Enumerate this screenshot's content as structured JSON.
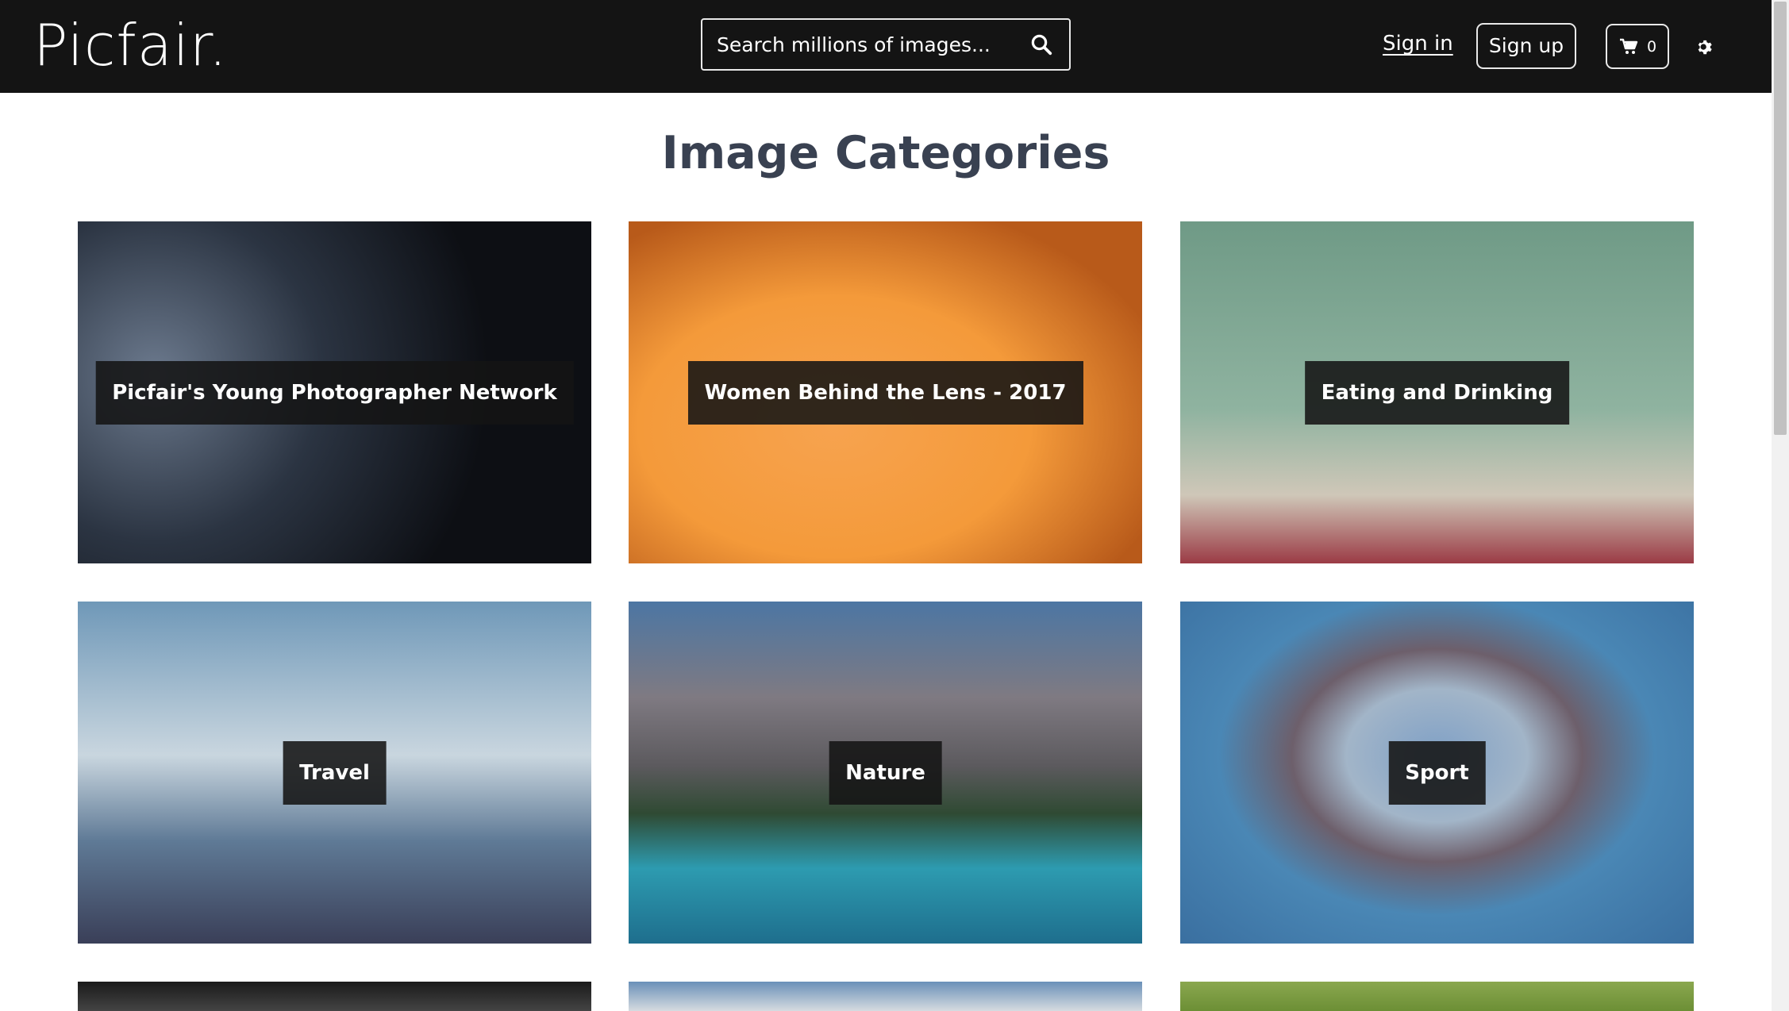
{
  "header": {
    "logo": "Picfair.",
    "search_placeholder": "Search millions of images...",
    "signin_label": "Sign in",
    "signup_label": "Sign up",
    "cart_count": "0",
    "icons": [
      "search-icon",
      "cart-icon",
      "gear-icon"
    ]
  },
  "main": {
    "title": "Image Categories",
    "categories": [
      {
        "label": "Picfair's Young Photographer Network"
      },
      {
        "label": "Women Behind the Lens - 2017"
      },
      {
        "label": "Eating and Drinking"
      },
      {
        "label": "Travel"
      },
      {
        "label": "Nature"
      },
      {
        "label": "Sport"
      },
      {
        "label": ""
      },
      {
        "label": ""
      },
      {
        "label": ""
      }
    ]
  },
  "colors": {
    "header_bg": "#141414",
    "heading": "#394151",
    "label_bg": "#141414"
  }
}
